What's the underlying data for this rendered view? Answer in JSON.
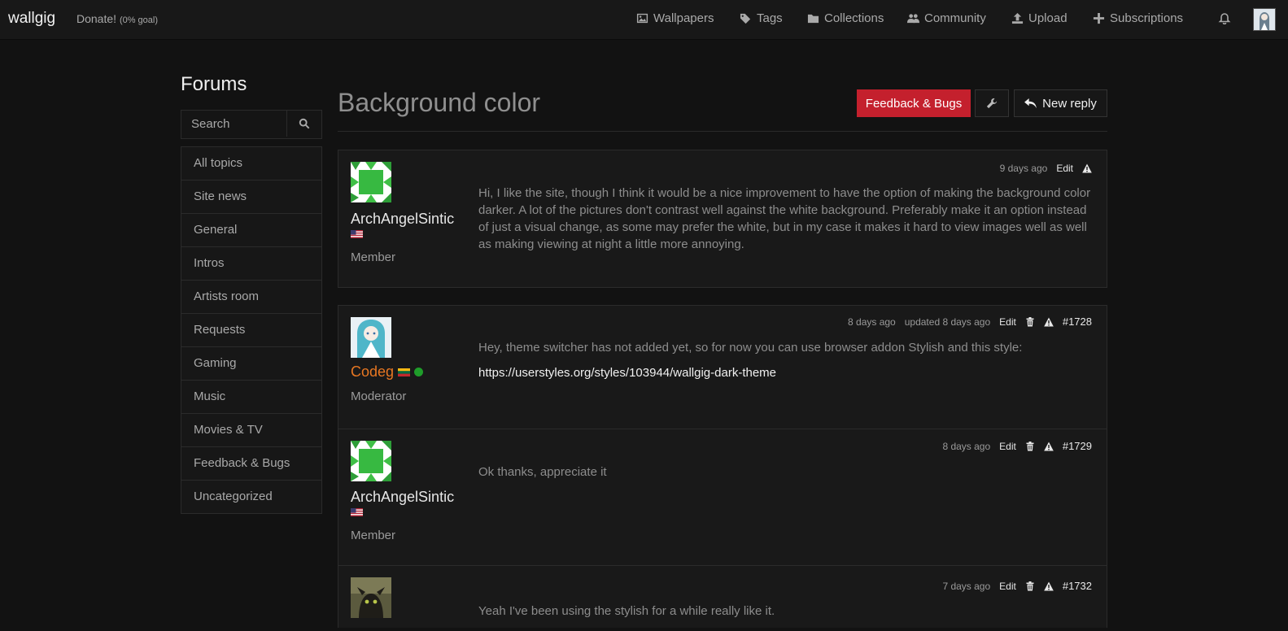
{
  "header": {
    "brand": "wallgig",
    "donate_label": "Donate!",
    "donate_goal": "(0% goal)",
    "nav": [
      {
        "label": "Wallpapers",
        "icon": "image-icon"
      },
      {
        "label": "Tags",
        "icon": "tags-icon"
      },
      {
        "label": "Collections",
        "icon": "folder-icon"
      },
      {
        "label": "Community",
        "icon": "users-icon"
      },
      {
        "label": "Upload",
        "icon": "upload-icon"
      },
      {
        "label": "Subscriptions",
        "icon": "plus-icon"
      }
    ]
  },
  "sidebar": {
    "title": "Forums",
    "search_placeholder": "Search",
    "topics": [
      "All topics",
      "Site news",
      "General",
      "Intros",
      "Artists room",
      "Requests",
      "Gaming",
      "Music",
      "Movies & TV",
      "Feedback & Bugs",
      "Uncategorized"
    ]
  },
  "thread": {
    "title": "Background color",
    "category_button": "Feedback & Bugs",
    "reply_button": "New reply",
    "posts": [
      {
        "author": "ArchAngelSintic",
        "role": "Member",
        "time": "9 days ago",
        "edit": "Edit",
        "body": "Hi, I like the site, though I think it would be a nice improvement to have the option of making the background color darker. A lot of the pictures don't contrast well against the white background. Preferably make it an option instead of just a visual change, as some may prefer the white, but in my case it makes it hard to view images well as well as making viewing at night a little more annoying."
      },
      {
        "author": "Codeg",
        "role": "Moderator",
        "time": "8 days ago",
        "updated": "updated 8 days ago",
        "edit": "Edit",
        "number": "#1728",
        "body": "Hey, theme switcher has not added yet, so for now you can use browser addon Stylish and this style:",
        "link": "https://userstyles.org/styles/103944/wallgig-dark-theme"
      },
      {
        "author": "ArchAngelSintic",
        "role": "Member",
        "time": "8 days ago",
        "edit": "Edit",
        "number": "#1729",
        "body": "Ok thanks, appreciate it"
      },
      {
        "time": "7 days ago",
        "edit": "Edit",
        "number": "#1732",
        "body": "Yeah I've been using the stylish for a while really like it."
      }
    ]
  },
  "colors": {
    "accent": "#c4202d",
    "moderator": "#e87722",
    "online": "#1f9d2a",
    "background": "#121212"
  }
}
